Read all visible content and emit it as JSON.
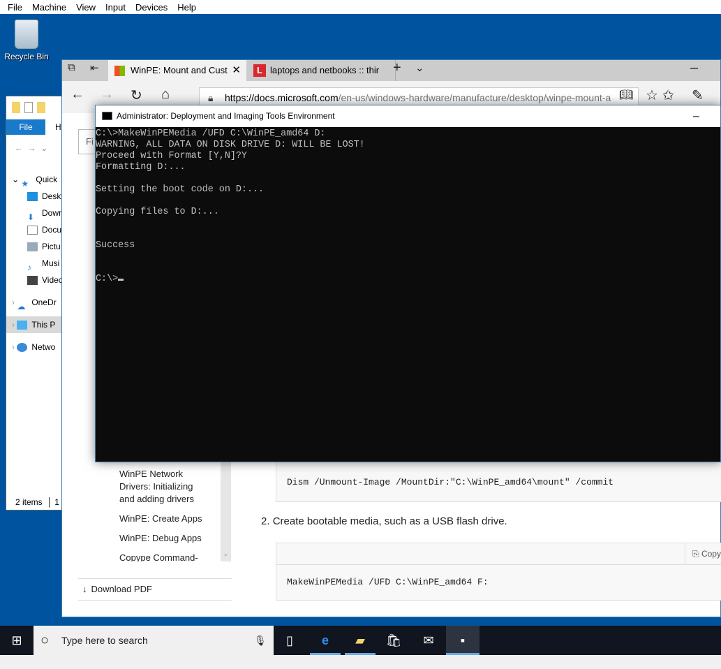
{
  "vm_menu": [
    "File",
    "Machine",
    "View",
    "Input",
    "Devices",
    "Help"
  ],
  "desktop": {
    "recycle_bin": "Recycle Bin"
  },
  "explorer": {
    "file_tab": "File",
    "home_tab": "H",
    "nav": [
      {
        "label": "Quick",
        "icon": "star-icon"
      },
      {
        "label": "Deskt",
        "icon": "desktop-icon"
      },
      {
        "label": "Dowr",
        "icon": "download-icon"
      },
      {
        "label": "Docu",
        "icon": "document-icon"
      },
      {
        "label": "Pictu",
        "icon": "pictures-icon"
      },
      {
        "label": "Musi",
        "icon": "music-icon"
      },
      {
        "label": "Videc",
        "icon": "video-icon"
      },
      {
        "label": "OneDr",
        "icon": "onedrive-icon"
      },
      {
        "label": "This P",
        "icon": "computer-icon"
      },
      {
        "label": "Netwo",
        "icon": "network-icon"
      }
    ],
    "status": "2 items",
    "status2": "1"
  },
  "edge": {
    "tabs": [
      {
        "label": "WinPE: Mount and Cust"
      },
      {
        "label": "laptops and netbooks :: thir"
      }
    ],
    "url_domain": "https://docs.microsoft.com",
    "url_path": "/en-us/windows-hardware/manufacture/desktop/winpe-mount-a",
    "page": {
      "filter": "Fi",
      "side_items": [
        "WinPE Network Drivers: Initializing and adding drivers",
        "WinPE: Create Apps",
        "WinPE: Debug Apps",
        "Copype Command-"
      ],
      "download_pdf": "Download PDF",
      "code1": "Dism /Unmount-Image /MountDir:\"C:\\WinPE_amd64\\mount\" /commit",
      "step2_num": "2.",
      "step2": "Create bootable media, such as a USB flash drive.",
      "copy": "Copy",
      "code2": "MakeWinPEMedia /UFD C:\\WinPE_amd64 F:"
    }
  },
  "cmd": {
    "title": "Administrator: Deployment and Imaging Tools Environment",
    "output": "C:\\>MakeWinPEMedia /UFD C:\\WinPE_amd64 D:\nWARNING, ALL DATA ON DISK DRIVE D: WILL BE LOST!\nProceed with Format [Y,N]?Y\nFormatting D:...\n\nSetting the boot code on D:...\n\nCopying files to D:...\n\n\nSuccess\n\n\nC:\\>"
  },
  "taskbar": {
    "search_placeholder": "Type here to search"
  }
}
